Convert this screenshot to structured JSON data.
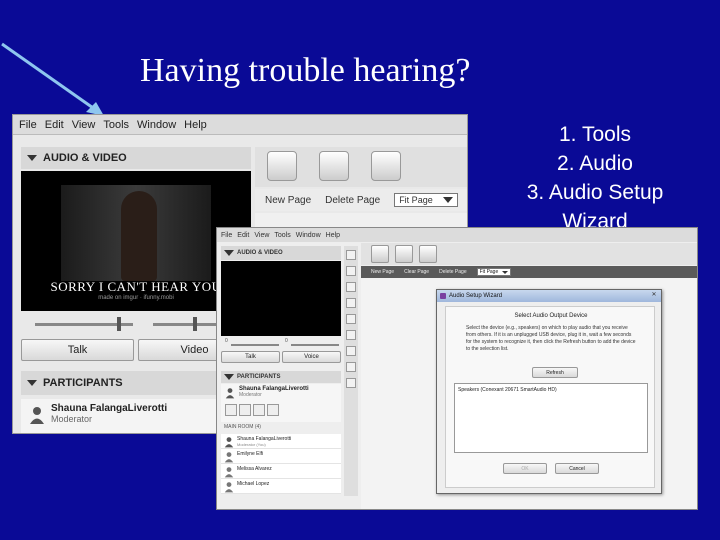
{
  "slide": {
    "title": "Having trouble hearing?",
    "steps": [
      "1. Tools",
      "2. Audio",
      "3. Audio Setup",
      "Wizard"
    ]
  },
  "colors": {
    "slide_background": "#0a0a96",
    "arrow": "#8ec6ef",
    "text": "#ffffff"
  },
  "screenshot1": {
    "menu": [
      "File",
      "Edit",
      "View",
      "Tools",
      "Window",
      "Help"
    ],
    "av_pod_title": "AUDIO & VIDEO",
    "video_caption": "SORRY I CAN'T HEAR YOU",
    "video_subcaption": "made on imgur · ifunny.mobi",
    "buttons": {
      "talk": "Talk",
      "video": "Video"
    },
    "participants_title": "PARTICIPANTS",
    "participant": {
      "name": "Shauna FalangaLiverotti",
      "role": "Moderator"
    },
    "page_toolbar": {
      "new_page": "New Page",
      "delete_page": "Delete Page",
      "fit_select": "Fit Page"
    },
    "icons": [
      "pen-tablet-icon",
      "pages-icon",
      "globe-share-icon"
    ]
  },
  "screenshot2": {
    "menu": [
      "File",
      "Edit",
      "View",
      "Tools",
      "Window",
      "Help"
    ],
    "av_pod_title": "AUDIO & VIDEO",
    "volume_labels": [
      "0",
      "0"
    ],
    "buttons": {
      "talk": "Talk",
      "voice": "Voice"
    },
    "participants_title": "PARTICIPANTS",
    "presenter": {
      "name": "Shauna FalangaLiverotti",
      "role": "Moderator"
    },
    "main_room_label": "MAIN ROOM (4)",
    "participants": [
      {
        "name": "Shauna FalangaLiverotti",
        "role": "Moderator (You)"
      },
      {
        "name": "Emilyne Elfi",
        "role": ""
      },
      {
        "name": "Melissa Alvarez",
        "role": ""
      },
      {
        "name": "Michael Lopez",
        "role": ""
      }
    ],
    "page_toolbar": {
      "new_page": "New Page",
      "clear_page": "Clear Page",
      "delete_page": "Delete Page",
      "fit_select": "Fit Page"
    }
  },
  "dialog": {
    "title": "Audio Setup Wizard",
    "close_label": "✕",
    "heading": "Select Audio Output Device",
    "instructions": "Select the device (e.g., speakers) on which to play audio that you receive from others. If it is an unplugged USB device, plug it in, wait a few seconds for the system to recognize it, then click the Refresh button to add the device to the selection list.",
    "refresh_label": "Refresh",
    "device": "Speakers (Conexant 20671 SmartAudio HD)",
    "ok_label": "OK",
    "cancel_label": "Cancel"
  }
}
